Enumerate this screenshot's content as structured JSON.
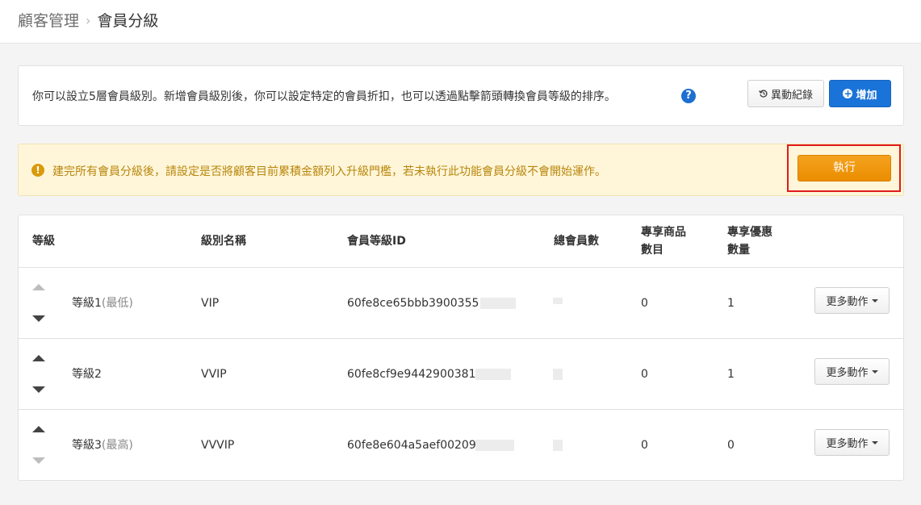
{
  "breadcrumb": {
    "parent": "顧客管理",
    "separator": "›",
    "current": "會員分級"
  },
  "info": {
    "text": "你可以設立5層會員級別。新增會員級別後，你可以設定特定的會員折扣，也可以透過點擊箭頭轉換會員等級的排序。",
    "help": "?",
    "log_label": "異動紀錄",
    "log_icon": "history-icon",
    "add_label": "增加",
    "add_icon": "plus-circle-icon"
  },
  "warning": {
    "icon": "!",
    "text": "建完所有會員分級後，請設定是否將顧客目前累積金額列入升級門檻，若未執行此功能會員分級不會開始運作。",
    "run_label": "執行"
  },
  "table": {
    "headers": {
      "level": "等級",
      "name": "級別名稱",
      "id": "會員等級ID",
      "members": "總會員數",
      "products_line1": "專享商品",
      "products_line2": "數目",
      "offers_line1": "專享優惠",
      "offers_line2": "數量"
    },
    "rows": [
      {
        "level": "等級1",
        "note": "(最低)",
        "name": "VIP",
        "id": "60fe8ce65bbb3900355",
        "products": "0",
        "offers": "1",
        "more": "更多動作"
      },
      {
        "level": "等級2",
        "note": "",
        "name": "VVIP",
        "id": "60fe8cf9e9442900381",
        "products": "0",
        "offers": "1",
        "more": "更多動作"
      },
      {
        "level": "等級3",
        "note": "(最高)",
        "name": "VVVIP",
        "id": "60fe8e604a5aef00209",
        "products": "0",
        "offers": "0",
        "more": "更多動作"
      }
    ]
  },
  "colors": {
    "primary": "#1a73d8",
    "warning_bg": "#fff6da",
    "warning_text": "#b8860b",
    "run_button": "#ea8d00",
    "highlight": "#e01a1a"
  }
}
